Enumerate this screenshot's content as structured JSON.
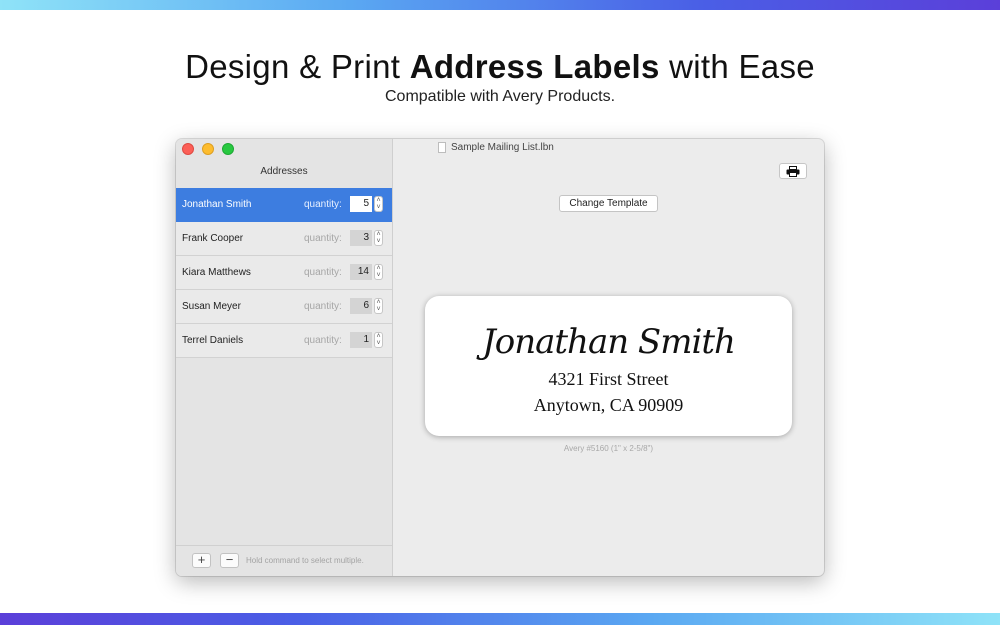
{
  "hero": {
    "title_pre": "Design & Print ",
    "title_bold": "Address Labels",
    "title_post": " with Ease",
    "subtitle": "Compatible with Avery Products."
  },
  "colors": {
    "selection": "#3d7de0",
    "close": "#fc5f57",
    "minimize": "#fdbc2e",
    "zoom": "#28c840"
  },
  "window": {
    "document_title": "Sample Mailing List.lbn",
    "document_icon": "document-icon"
  },
  "sidebar": {
    "title": "Addresses",
    "quantity_label": "quantity:",
    "rows": [
      {
        "name": "Jonathan Smith",
        "quantity": "5",
        "selected": true
      },
      {
        "name": "Frank Cooper",
        "quantity": "3",
        "selected": false
      },
      {
        "name": "Kiara Matthews",
        "quantity": "14",
        "selected": false
      },
      {
        "name": "Susan Meyer",
        "quantity": "6",
        "selected": false
      },
      {
        "name": "Terrel Daniels",
        "quantity": "1",
        "selected": false
      }
    ],
    "add_label": "+",
    "remove_label": "−",
    "hint": "Hold command to select multiple."
  },
  "main": {
    "print_icon": "printer-icon",
    "change_template_label": "Change Template",
    "label": {
      "name": "Jonathan Smith",
      "line1": "4321 First Street",
      "line2": "Anytown, CA 90909"
    },
    "template_caption": "Avery #5160 (1\" x 2-5/8\")"
  }
}
